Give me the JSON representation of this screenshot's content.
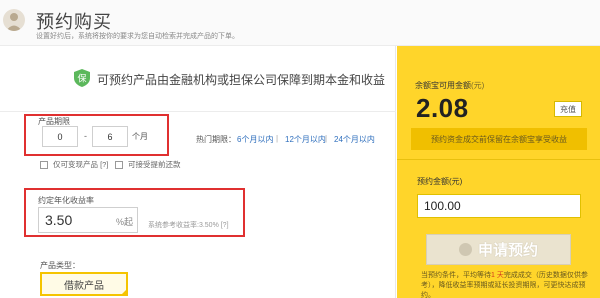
{
  "header": {
    "title": "预约购买",
    "subtitle": "设置好约后，系统将按你的要求为您自动检索并完成产品的下单。"
  },
  "banner": {
    "text": "可预约产品由金融机构或担保公司保障到期本金和收益"
  },
  "period": {
    "label": "产品期限",
    "from": "0",
    "to": "6",
    "dash": "-",
    "unit": "个月"
  },
  "quick": {
    "label": "热门期限：",
    "links": [
      "6个月以内",
      "12个月以内",
      "24个月以内"
    ],
    "separator": "|"
  },
  "checkboxes": [
    {
      "label": "仅可变现产品 [?]"
    },
    {
      "label": "可接受提前还款"
    }
  ],
  "rate": {
    "label": "约定年化收益率",
    "value": "3.50",
    "unit": "%起",
    "hint": "系统参考收益率:3.50% [?]"
  },
  "type": {
    "label": "产品类型：",
    "selected": "借款产品"
  },
  "sidebar": {
    "balance_label": "余额宝可用金额",
    "balance_unit": "(元)",
    "balance": "2.08",
    "recharge": "充值",
    "note": "预约资金成交前保留在余额宝享受收益",
    "amount_label": "预约金额",
    "amount_unit": "(元)",
    "amount_value": "100.00",
    "apply": "申请预约",
    "footnote_a": "当预约条件，平均等待",
    "footnote_days": "1 天",
    "footnote_b": "完成成交（历史数据仅供参考），降低收益率预期或延长投资期限，可更快达成预约。"
  },
  "colors": {
    "brand_yellow": "#ffd52a",
    "highlight_red": "#e03030",
    "link_blue": "#2f6fbd"
  }
}
